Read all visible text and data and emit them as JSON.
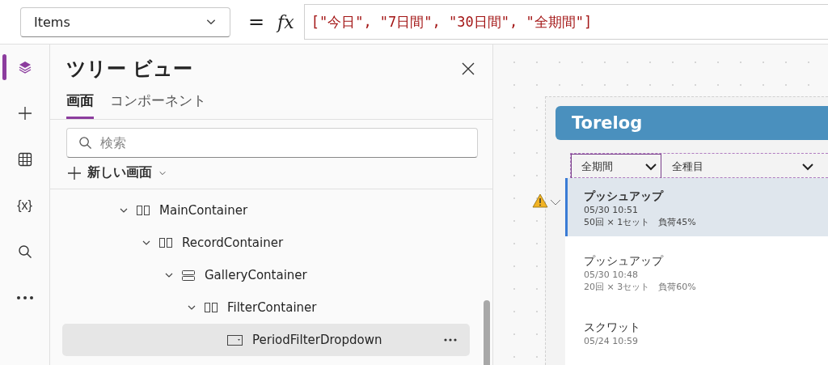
{
  "property_selector": {
    "value": "Items"
  },
  "formula": {
    "equals": "=",
    "fx": "fx",
    "text": "[\"今日\", \"7日間\", \"30日間\", \"全期間\"]"
  },
  "rail": [
    {
      "kind": "layers",
      "selected": true
    },
    {
      "kind": "add",
      "selected": false
    },
    {
      "kind": "table",
      "selected": false
    },
    {
      "kind": "text",
      "label": "{x}",
      "selected": false
    },
    {
      "kind": "search",
      "selected": false
    },
    {
      "kind": "more",
      "selected": false
    }
  ],
  "tree_view": {
    "title": "ツリー ビュー",
    "tabs": [
      {
        "label": "画面",
        "selected": true
      },
      {
        "label": "コンポーネント",
        "selected": false
      }
    ],
    "search": {
      "placeholder": "検索"
    },
    "new_screen": "新しい画面",
    "nodes": [
      {
        "name": "MainContainer",
        "kind": "container",
        "expanded": true,
        "selected": false,
        "children": [
          {
            "name": "RecordContainer",
            "kind": "container",
            "expanded": true,
            "selected": false,
            "children": [
              {
                "name": "GalleryContainer",
                "kind": "gallery",
                "expanded": true,
                "selected": false,
                "children": [
                  {
                    "name": "FilterContainer",
                    "kind": "container",
                    "expanded": true,
                    "selected": false,
                    "children": [
                      {
                        "name": "PeriodFilterDropdown",
                        "kind": "dropdown",
                        "selected": true
                      }
                    ]
                  }
                ]
              }
            ]
          }
        ]
      }
    ]
  },
  "app": {
    "title": "Torelog",
    "warning": true,
    "filters": [
      {
        "value": "全期間",
        "selected": true
      },
      {
        "value": "全種目",
        "selected": false
      }
    ],
    "records": [
      {
        "name": "プッシュアップ",
        "time": "05/30 10:51",
        "detail": "50回 × 1セット　負荷45%",
        "selected": true
      },
      {
        "name": "プッシュアップ",
        "time": "05/30 10:48",
        "detail": "20回 × 3セット　負荷60%",
        "selected": false
      },
      {
        "name": "スクワット",
        "time": "05/24 10:59",
        "selected": false
      }
    ]
  }
}
